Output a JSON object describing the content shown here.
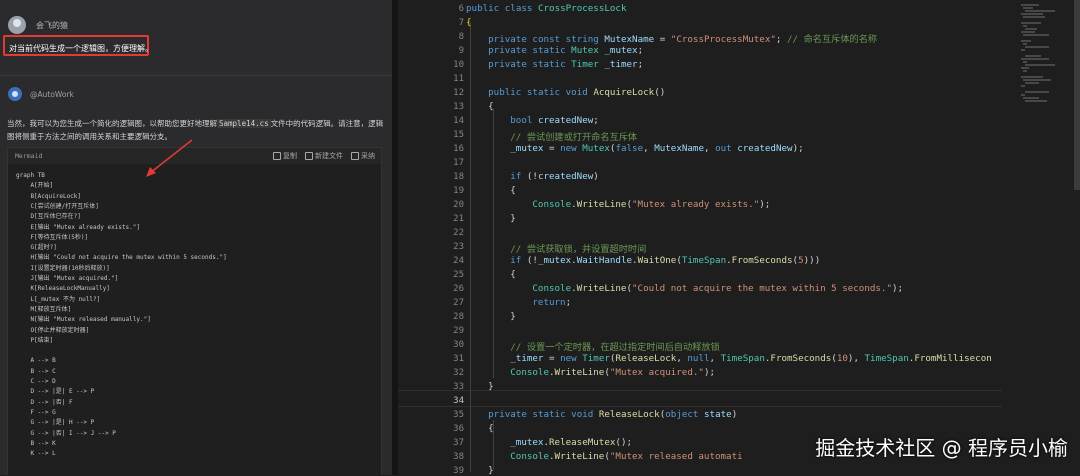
{
  "left_panel": {
    "user_name": "会飞的猿",
    "prompt": "对当前代码生成一个逻辑图，方便理解。",
    "bot_name": "@AutoWork",
    "answer_line1": "当然，我可以为您生成一个简化的逻辑图，以帮助您更好地理解",
    "answer_file": "Sample14.cs",
    "answer_line1b": "文件中的代码逻辑。请注意，逻辑",
    "answer_line2": "图将侧重于方法之间的调用关系和主要逻辑分支。",
    "code_block": {
      "lang": "Mermaid",
      "actions": [
        "复制",
        "新建文件",
        "采纳"
      ],
      "lines": [
        "graph TB",
        "    A[开始]",
        "    B[AcquireLock]",
        "    C[尝试创建/打开互斥体]",
        "    D[互斥体已存在?]",
        "    E[输出 \"Mutex already exists.\"]",
        "    F[等待互斥体(5秒)]",
        "    G[超时?]",
        "    H[输出 \"Could not acquire the mutex within 5 seconds.\"]",
        "    I[设置定时器(10秒后释放)]",
        "    J[输出 \"Mutex acquired.\"]",
        "    K[ReleaseLockManually]",
        "    L[_mutex 不为 null?]",
        "    M[释放互斥体]",
        "    N[输出 \"Mutex released manually.\"]",
        "    O[停止并释放定时器]",
        "    P[结束]",
        "",
        "    A --> B",
        "    B --> C",
        "    C --> D",
        "    D --> |是| E --> P",
        "    D --> |否| F",
        "    F --> G",
        "    G --> |是| H --> P",
        "    G --> |否| I --> J --> P",
        "    B --> K",
        "    K --> L"
      ]
    }
  },
  "editor": {
    "line_numbers": [
      "6",
      "7",
      "8",
      "9",
      "10",
      "11",
      "12",
      "13",
      "14",
      "15",
      "16",
      "17",
      "18",
      "19",
      "20",
      "21",
      "22",
      "23",
      "24",
      "25",
      "26",
      "27",
      "28",
      "29",
      "30",
      "31",
      "32",
      "33",
      "34",
      "35",
      "36",
      "37",
      "38",
      "39"
    ],
    "active_line": "34"
  },
  "watermark": "掘金技术社区 @ 程序员小榆"
}
